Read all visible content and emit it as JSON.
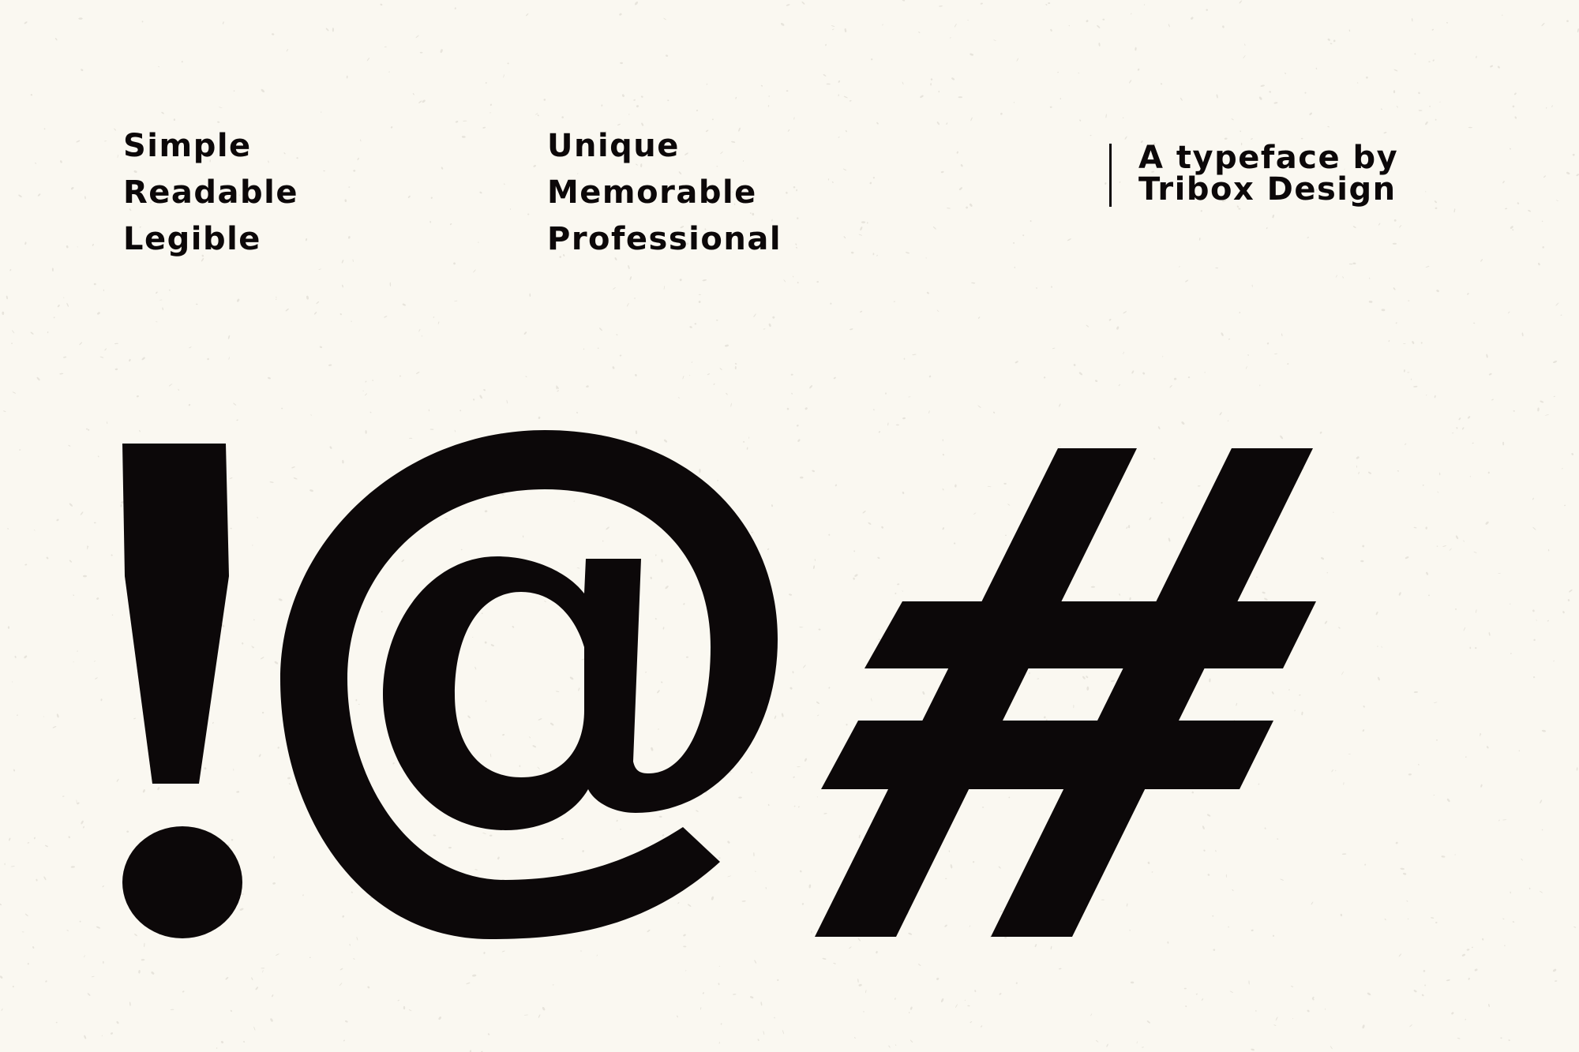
{
  "taglines": {
    "column_1": [
      "Simple",
      "Readable",
      "Legible"
    ],
    "column_2": [
      "Unique",
      "Memorable",
      "Professional"
    ]
  },
  "credit": {
    "line_1": "A typeface by",
    "line_2": "Tribox Design"
  },
  "specimen": {
    "glyphs": [
      "!",
      "@",
      "#"
    ]
  },
  "colors": {
    "background": "#faf8f1",
    "ink": "#0c0809"
  }
}
